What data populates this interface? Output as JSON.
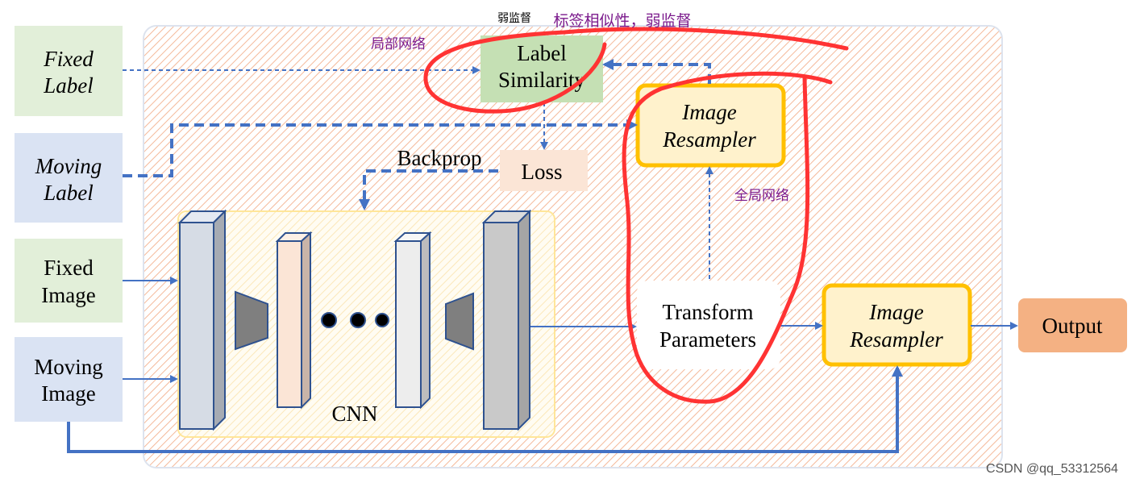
{
  "inputs": {
    "fixed_label": [
      "Fixed",
      "Label"
    ],
    "moving_label": [
      "Moving",
      "Label"
    ],
    "fixed_image": [
      "Fixed",
      "Image"
    ],
    "moving_image": [
      "Moving",
      "Image"
    ]
  },
  "nodes": {
    "label_similarity": [
      "Label",
      "Similarity"
    ],
    "loss": "Loss",
    "backprop": "Backprop",
    "cnn": "CNN",
    "resampler_top": [
      "Image",
      "Resampler"
    ],
    "transform_parameters": [
      "Transform",
      "Parameters"
    ],
    "resampler_bottom": [
      "Image",
      "Resampler"
    ],
    "output": "Output"
  },
  "annotations": {
    "weak_supervision": "弱监督",
    "label_similarity_weak": "标签相似性，弱监督",
    "local_network": "局部网络",
    "global_network": "全局网络"
  },
  "watermark": "CSDN @qq_53312564",
  "colors": {
    "arrow": "#4472c4",
    "annotation_ink": "#ff3333",
    "annotation_text": "#7b1a8c",
    "resampler_border": "#ffc000",
    "output_fill": "#f4b183"
  }
}
